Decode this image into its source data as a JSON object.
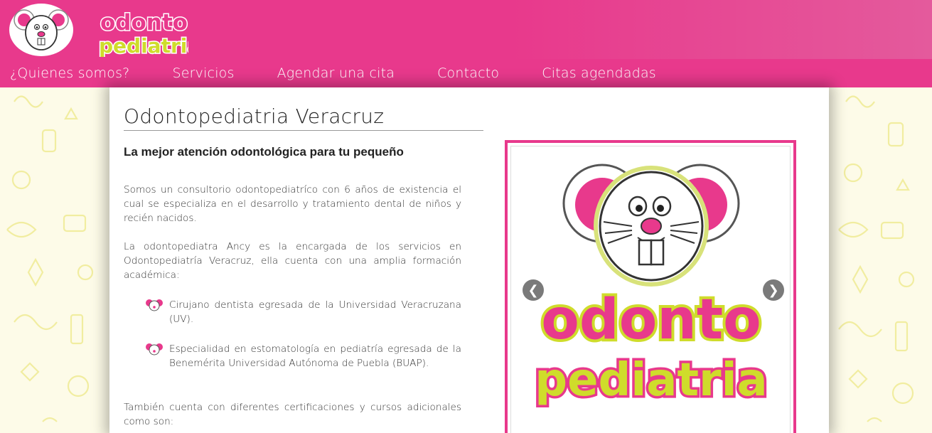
{
  "header": {
    "logo_icon": "mouse-mascot-icon",
    "logo_text_line1": "odonto",
    "logo_text_line2": "pediatria"
  },
  "nav": {
    "items": [
      {
        "label": "¿Quienes somos?"
      },
      {
        "label": "Servicios"
      },
      {
        "label": "Agendar una cita"
      },
      {
        "label": "Contacto"
      },
      {
        "label": "Citas agendadas"
      }
    ]
  },
  "main": {
    "title": "Odontopediatria Veracruz",
    "subtitle": "La mejor atención odontológica para tu pequeño",
    "para1": "Somos un consultorio odontopediatríco con 6 años de existencia el cual se especializa en el desarrollo y tratamiento dental de niños y recién nacidos.",
    "para2": "La odontopediatra Ancy es la encargada de los servicios en Odontopediatría Veracruz, ella cuenta con una amplia formación académica:",
    "list": [
      {
        "text": "Cirujano dentista egresada de la Universidad Veracruzana (UV)."
      },
      {
        "text": "Especialidad en estomatología en pediatría egresada de la Benemérita Universidad Autónoma de Puebla (BUAP)."
      }
    ],
    "para3": "También cuenta con diferentes certificaciones y cursos adicionales como son:"
  },
  "slider": {
    "prev_label": "❮",
    "next_label": "❯",
    "image_text_line1": "odonto",
    "image_text_line2": "pediatria"
  },
  "colors": {
    "brand_pink": "#e8398c",
    "brand_lime": "#cfdc2b",
    "pattern": "#f3f0a6"
  }
}
